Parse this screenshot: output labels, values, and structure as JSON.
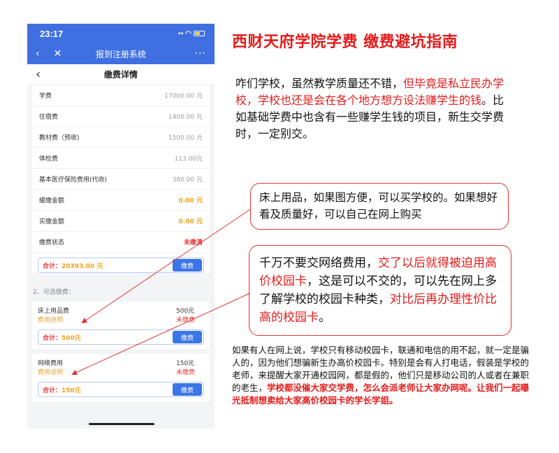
{
  "status_bar": {
    "time": "23:17"
  },
  "app_bar": {
    "back_icon": "‹",
    "close_icon": "✕",
    "title": "报到注册系统",
    "more_icon": "···"
  },
  "nav_bar": {
    "back_icon": "‹",
    "title": "缴费详情"
  },
  "fees": [
    {
      "name": "学费",
      "value": "17000.00 元"
    },
    {
      "name": "住宿费",
      "value": "1400.00 元"
    },
    {
      "name": "教材费（预收)",
      "value": "1500.00 元"
    },
    {
      "name": "体检费",
      "value": "113.00元"
    },
    {
      "name": "基本医疗保险费用(代收)",
      "value": "380.00 元"
    },
    {
      "name": "缓缴金额",
      "value": "0.00 元"
    },
    {
      "name": "实缴金额",
      "value": "0.00 元"
    },
    {
      "name": "缴费状态",
      "value": "未缴清"
    }
  ],
  "total": {
    "label": "合计：",
    "value": "20393.00 元",
    "button": "缴费"
  },
  "optional_section": {
    "title": "2、可选缴费："
  },
  "optional_items": [
    {
      "name": "床上用品费",
      "price": "500元",
      "link": "费用说明",
      "status": "未缴费",
      "total_label": "合计：",
      "total_value": "500元",
      "button": "缴费"
    },
    {
      "name": "网络费用",
      "price": "150元",
      "link": "费用说明",
      "status": "未缴费",
      "total_label": "合计：",
      "total_value": "150元",
      "button": "缴费"
    }
  ],
  "article": {
    "headline": "西财天府学院学费  缴费避坑指南",
    "intro_black1": "咋们学校，虽然教学质量还不错，",
    "intro_red": "但毕竟是私立民办学校，学校也还是会在各个地方想方设法赚学生的钱",
    "intro_black2": "。比如基础学费中也含有一些赚学生钱的项目，新生交学费时，一定别交。",
    "bubble1": "床上用品，如果图方便，可以买学校的。如果想好看及质量好，可以自己在网上购买",
    "bubble2_black1": "千万不要交网络费用，",
    "bubble2_red1": "交了以后就得被迫用高价校园卡",
    "bubble2_black2": "，这是可以不交的，可以先在网上多了解学校的校园卡种类，",
    "bubble2_red2": "对比后再办理性价比高的校园卡",
    "bubble2_black3": "。",
    "footer_black": "如果有人在网上说，学校只有移动校园卡，联通和电信的用不起，就一定是骗人的，因为他们想骗新生办高价校园卡。特别是会有人打电话，假装是学校的老师，来提醒大家开通校园网，都是假的，他们只是移动公司的人或者在兼职的老生，",
    "footer_red": "学校都没催大家交学费，怎么会派老师让大家办网呢。让我们一起曝光抵制想卖给大家高价校园卡的学长学姐。"
  },
  "colors": {
    "brand_blue": "#3f6fe0",
    "accent_red": "#e21b1b",
    "orange": "#f0a020"
  }
}
